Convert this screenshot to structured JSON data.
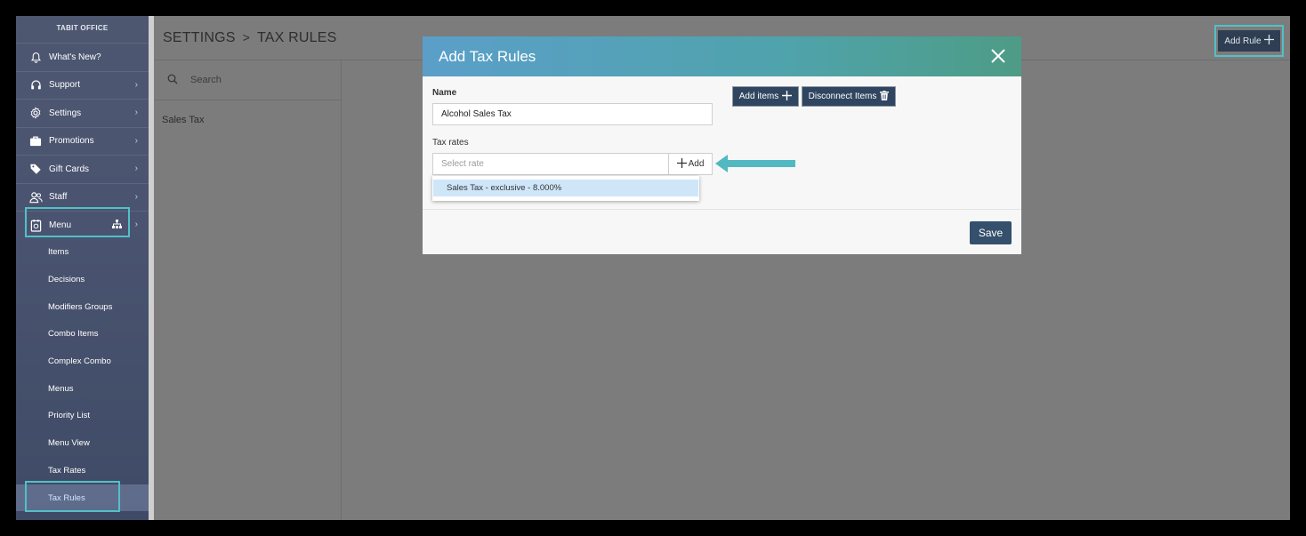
{
  "sidebar": {
    "brand": "TABIT OFFICE",
    "items": [
      {
        "label": "What's New?",
        "icon": "bell-icon"
      },
      {
        "label": "Support",
        "icon": "headset-icon"
      },
      {
        "label": "Settings",
        "icon": "gear-icon"
      },
      {
        "label": "Promotions",
        "icon": "briefcase-icon"
      },
      {
        "label": "Gift Cards",
        "icon": "tag-icon"
      },
      {
        "label": "Staff",
        "icon": "users-icon"
      },
      {
        "label": "Menu",
        "icon": "menu-book-icon"
      }
    ],
    "sub_items": [
      "Items",
      "Decisions",
      "Modifiers Groups",
      "Combo Items",
      "Complex Combo",
      "Menus",
      "Priority List",
      "Menu View",
      "Tax Rates",
      "Tax Rules"
    ]
  },
  "header": {
    "crumb_1": "SETTINGS",
    "crumb_sep": ">",
    "crumb_2": "TAX RULES",
    "add_rule_label": "Add Rule"
  },
  "list_panel": {
    "search_placeholder": "Search",
    "items": [
      "Sales Tax"
    ]
  },
  "modal": {
    "title": "Add Tax Rules",
    "name_label": "Name",
    "name_value": "Alcohol Sales Tax",
    "add_items_label": "Add items",
    "disconnect_items_label": "Disconnect Items",
    "tax_rates_label": "Tax rates",
    "select_placeholder": "Select rate",
    "add_label": "Add",
    "dropdown_option": "Sales Tax - exclusive - 8.000%",
    "save_label": "Save"
  },
  "colors": {
    "highlight": "#52c0c8",
    "primary_button": "#34506c",
    "header_gradient_start": "#5b9fc9",
    "header_gradient_end": "#4e9c86"
  }
}
